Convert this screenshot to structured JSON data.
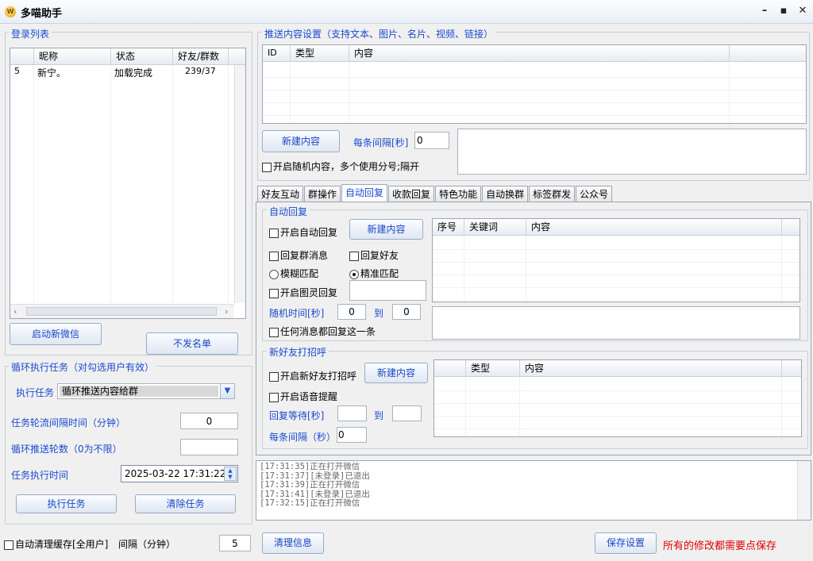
{
  "window": {
    "title": "多喵助手",
    "minimize": "–",
    "maximize": "▪",
    "close": "✕"
  },
  "login": {
    "legend": "登录列表",
    "columns": [
      "",
      "昵称",
      "状态",
      "好友/群数"
    ],
    "rows": [
      {
        "id": "5",
        "nickname": "新宁。",
        "status": "加载完成",
        "counts": "239/37"
      }
    ],
    "start_wechat": "启动新微信",
    "no_send_list": "不发名单"
  },
  "loop": {
    "legend": "循环执行任务（对勾选用户有效）",
    "exec_task_label": "执行任务",
    "exec_task_value": "循环推送内容给群",
    "interval_label": "任务轮流间隔时间（分钟）",
    "interval_value": "0",
    "rounds_label": "循环推送轮数（0为不限）",
    "rounds_value": "",
    "time_label": "任务执行时间",
    "time_value": "2025-03-22 17:31:22",
    "run_btn": "执行任务",
    "clear_btn": "清除任务"
  },
  "cache": {
    "label": "自动清理缓存[全用户]",
    "interval_label": "间隔（分钟）",
    "interval_value": "5"
  },
  "push": {
    "legend": "推送内容设置（支持文本、图片、名片、视频、链接）",
    "columns": [
      "ID",
      "类型",
      "内容",
      ""
    ],
    "new_btn": "新建内容",
    "interval_label": "每条间隔[秒]",
    "interval_value": "0",
    "random_label": "开启随机内容，多个使用分号;隔开"
  },
  "tabs": [
    "好友互动",
    "群操作",
    "自动回复",
    "收款回复",
    "特色功能",
    "自动换群",
    "标签群发",
    "公众号"
  ],
  "auto_reply": {
    "legend": "自动回复",
    "enable": "开启自动回复",
    "new_btn": "新建内容",
    "reply_group": "回复群消息",
    "reply_friend": "回复好友",
    "fuzzy": "模糊匹配",
    "exact": "精准匹配",
    "tuling": "开启图灵回复",
    "random_time": "随机时间[秒]",
    "from": "0",
    "to_label": "到",
    "to": "0",
    "any_msg": "任何消息都回复这一条",
    "columns": [
      "序号",
      "关键词",
      "内容",
      ""
    ]
  },
  "greet": {
    "legend": "新好友打招呼",
    "enable": "开启新好友打招呼",
    "new_btn": "新建内容",
    "voice": "开启语音提醒",
    "wait": "回复等待[秒]",
    "to_label": "到",
    "each_interval": "每条间隔（秒）",
    "each_value": "0",
    "columns": [
      "",
      "类型",
      "内容",
      ""
    ]
  },
  "log": {
    "lines": [
      "[17:31:35]正在打开微信",
      "[17:31:37][未登录]已退出",
      "[17:31:39]正在打开微信",
      "[17:31:41][未登录]已退出",
      "[17:32:15]正在打开微信"
    ]
  },
  "footer": {
    "clear_info": "清理信息",
    "save": "保存设置",
    "notice": "所有的修改都需要点保存"
  },
  "colors": {
    "accent": "#1a4ad0",
    "notice": "#e00000"
  }
}
